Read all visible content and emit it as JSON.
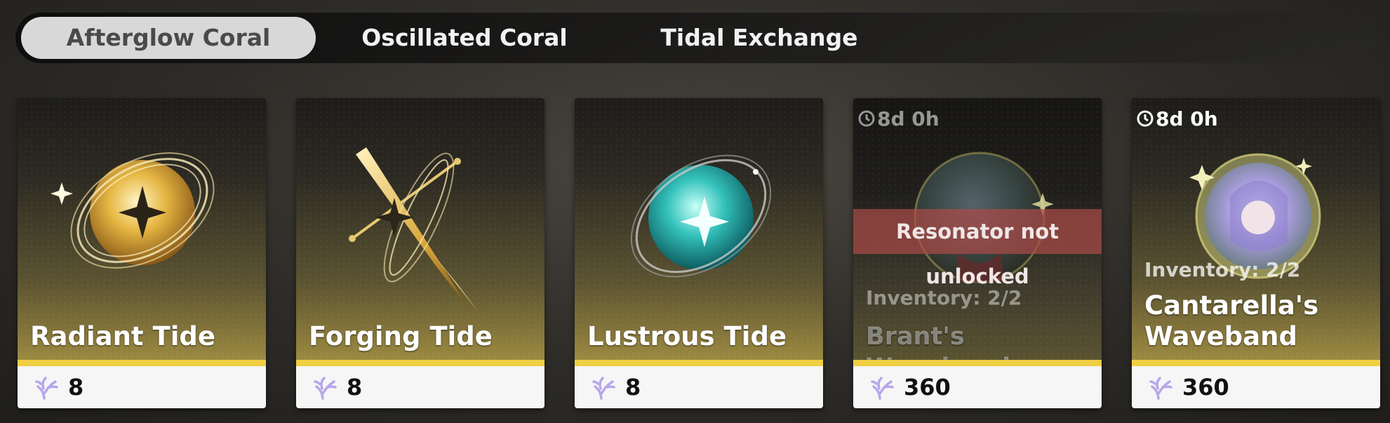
{
  "tabs": [
    {
      "label": "Afterglow Coral",
      "active": true
    },
    {
      "label": "Oscillated Coral",
      "active": false
    },
    {
      "label": "Tidal Exchange",
      "active": false
    }
  ],
  "items": [
    {
      "name": "Radiant Tide",
      "price": "8",
      "icon": "radiant-tide-orb-icon"
    },
    {
      "name": "Forging Tide",
      "price": "8",
      "icon": "forging-tide-blade-icon"
    },
    {
      "name": "Lustrous Tide",
      "price": "8",
      "icon": "lustrous-tide-orb-icon"
    },
    {
      "name": "Brant's Waveband",
      "price": "360",
      "timer": "8d 0h",
      "inventory": "Inventory: 2/2",
      "status": "Resonator not unlocked",
      "icon": "brant-portrait-icon"
    },
    {
      "name_line1": "Cantarella's",
      "name_line2": "Waveband",
      "price": "360",
      "timer": "8d 0h",
      "inventory": "Inventory: 2/2",
      "icon": "cantarella-portrait-icon"
    }
  ],
  "currency_icon": "afterglow-coral-icon",
  "colors": {
    "accent_gold": "#f0cf43",
    "locked_red": "#aa4b48",
    "tab_active_bg": "#d8d8d8"
  }
}
